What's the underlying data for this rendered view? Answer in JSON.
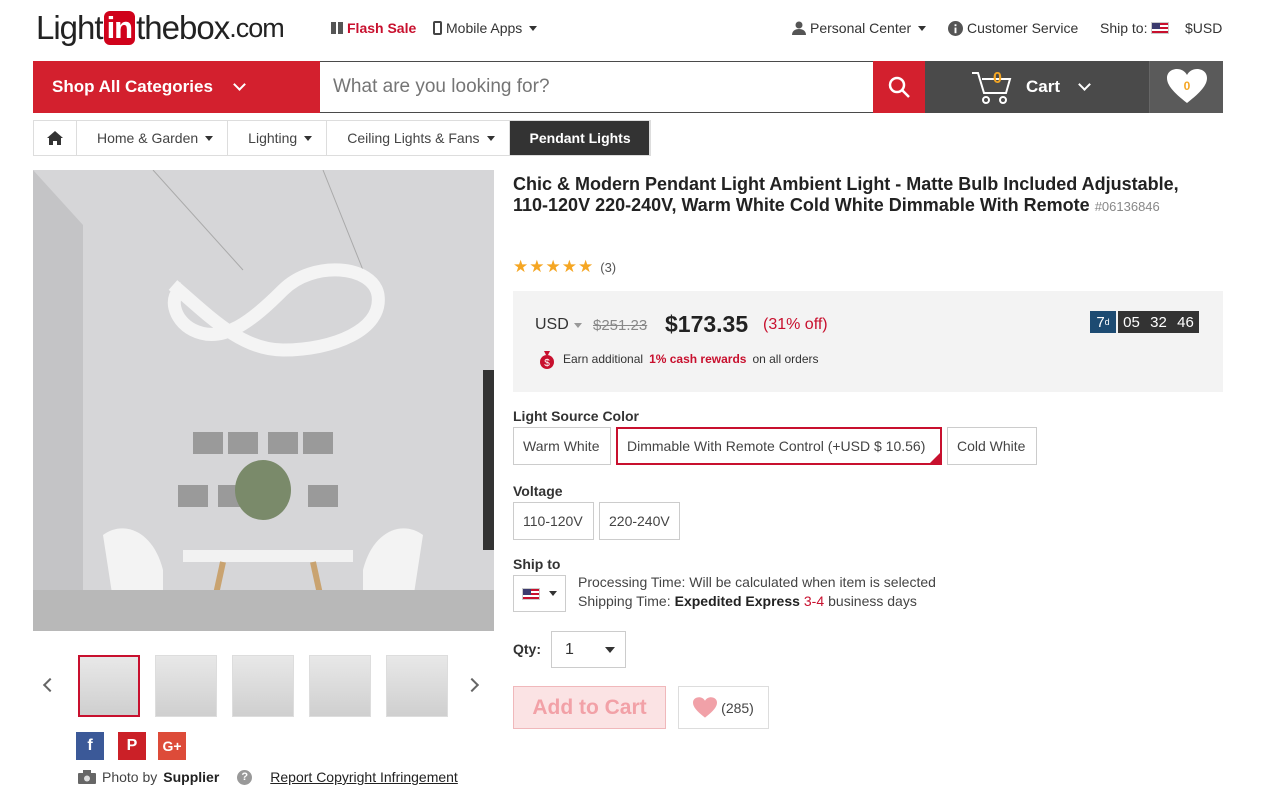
{
  "header": {
    "logo_pre": "Light",
    "logo_in": "in",
    "logo_post": "thebox",
    "logo_com": ".com",
    "flash_sale": "Flash Sale",
    "mobile_apps": "Mobile Apps",
    "personal_center": "Personal Center",
    "customer_service": "Customer Service",
    "ship_to": "Ship to:",
    "currency": "$USD"
  },
  "nav": {
    "shop_all": "Shop All Categories",
    "search_placeholder": "What are you looking for?",
    "cart_label": "Cart",
    "cart_count": "0",
    "wish_count": "0"
  },
  "breadcrumb": {
    "items": [
      "Home & Garden",
      "Lighting",
      "Ceiling Lights & Fans"
    ],
    "current": "Pendant Lights"
  },
  "product": {
    "title": "Chic & Modern Pendant Light Ambient Light - Matte Bulb Included Adjustable, 110-120V 220-240V, Warm White Cold White Dimmable With Remote",
    "code": "#06136846",
    "rating_count": "(3)",
    "currency_select": "USD",
    "old_price": "$251.23",
    "price": "$173.35",
    "discount": "(31% off)",
    "rewards_pre": "Earn additional",
    "rewards_highlight": "1% cash rewards",
    "rewards_post": "on all orders",
    "timer": {
      "days": "7",
      "days_unit": "d",
      "hours": "05",
      "minutes": "32",
      "seconds": "46"
    }
  },
  "options": {
    "light_source_label": "Light Source Color",
    "light_source": [
      "Warm White",
      "Dimmable With Remote Control (+USD $ 10.56)",
      "Cold White"
    ],
    "voltage_label": "Voltage",
    "voltage": [
      "110-120V",
      "220-240V"
    ],
    "ship_to_label": "Ship to",
    "processing_time": "Processing Time: Will be calculated when item is selected",
    "shipping_pre": "Shipping Time:",
    "shipping_method": "Expedited Express",
    "shipping_days": "3-4",
    "shipping_post": "business days",
    "qty_label": "Qty:",
    "qty_value": "1"
  },
  "actions": {
    "add_to_cart": "Add to Cart",
    "wishlist_count": "(285)"
  },
  "footer": {
    "photo_by": "Photo by",
    "supplier": "Supplier",
    "report": "Report Copyright Infringement"
  },
  "colors": {
    "brand_red": "#d3202e",
    "nav_dark": "#4a4a4a",
    "price_red": "#c8102e"
  }
}
